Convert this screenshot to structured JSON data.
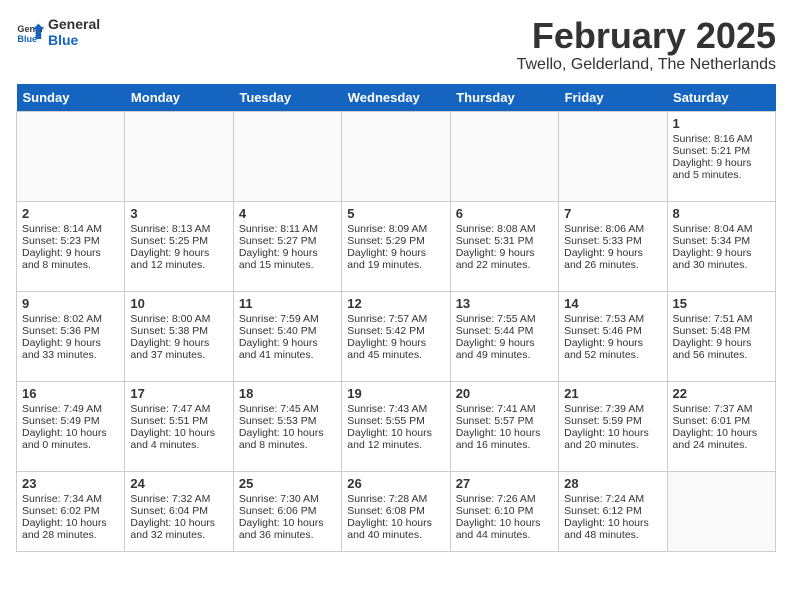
{
  "logo": {
    "line1": "General",
    "line2": "Blue"
  },
  "title": "February 2025",
  "subtitle": "Twello, Gelderland, The Netherlands",
  "weekdays": [
    "Sunday",
    "Monday",
    "Tuesday",
    "Wednesday",
    "Thursday",
    "Friday",
    "Saturday"
  ],
  "weeks": [
    [
      {
        "day": "",
        "info": ""
      },
      {
        "day": "",
        "info": ""
      },
      {
        "day": "",
        "info": ""
      },
      {
        "day": "",
        "info": ""
      },
      {
        "day": "",
        "info": ""
      },
      {
        "day": "",
        "info": ""
      },
      {
        "day": "1",
        "info": "Sunrise: 8:16 AM\nSunset: 5:21 PM\nDaylight: 9 hours and 5 minutes."
      }
    ],
    [
      {
        "day": "2",
        "info": "Sunrise: 8:14 AM\nSunset: 5:23 PM\nDaylight: 9 hours and 8 minutes."
      },
      {
        "day": "3",
        "info": "Sunrise: 8:13 AM\nSunset: 5:25 PM\nDaylight: 9 hours and 12 minutes."
      },
      {
        "day": "4",
        "info": "Sunrise: 8:11 AM\nSunset: 5:27 PM\nDaylight: 9 hours and 15 minutes."
      },
      {
        "day": "5",
        "info": "Sunrise: 8:09 AM\nSunset: 5:29 PM\nDaylight: 9 hours and 19 minutes."
      },
      {
        "day": "6",
        "info": "Sunrise: 8:08 AM\nSunset: 5:31 PM\nDaylight: 9 hours and 22 minutes."
      },
      {
        "day": "7",
        "info": "Sunrise: 8:06 AM\nSunset: 5:33 PM\nDaylight: 9 hours and 26 minutes."
      },
      {
        "day": "8",
        "info": "Sunrise: 8:04 AM\nSunset: 5:34 PM\nDaylight: 9 hours and 30 minutes."
      }
    ],
    [
      {
        "day": "9",
        "info": "Sunrise: 8:02 AM\nSunset: 5:36 PM\nDaylight: 9 hours and 33 minutes."
      },
      {
        "day": "10",
        "info": "Sunrise: 8:00 AM\nSunset: 5:38 PM\nDaylight: 9 hours and 37 minutes."
      },
      {
        "day": "11",
        "info": "Sunrise: 7:59 AM\nSunset: 5:40 PM\nDaylight: 9 hours and 41 minutes."
      },
      {
        "day": "12",
        "info": "Sunrise: 7:57 AM\nSunset: 5:42 PM\nDaylight: 9 hours and 45 minutes."
      },
      {
        "day": "13",
        "info": "Sunrise: 7:55 AM\nSunset: 5:44 PM\nDaylight: 9 hours and 49 minutes."
      },
      {
        "day": "14",
        "info": "Sunrise: 7:53 AM\nSunset: 5:46 PM\nDaylight: 9 hours and 52 minutes."
      },
      {
        "day": "15",
        "info": "Sunrise: 7:51 AM\nSunset: 5:48 PM\nDaylight: 9 hours and 56 minutes."
      }
    ],
    [
      {
        "day": "16",
        "info": "Sunrise: 7:49 AM\nSunset: 5:49 PM\nDaylight: 10 hours and 0 minutes."
      },
      {
        "day": "17",
        "info": "Sunrise: 7:47 AM\nSunset: 5:51 PM\nDaylight: 10 hours and 4 minutes."
      },
      {
        "day": "18",
        "info": "Sunrise: 7:45 AM\nSunset: 5:53 PM\nDaylight: 10 hours and 8 minutes."
      },
      {
        "day": "19",
        "info": "Sunrise: 7:43 AM\nSunset: 5:55 PM\nDaylight: 10 hours and 12 minutes."
      },
      {
        "day": "20",
        "info": "Sunrise: 7:41 AM\nSunset: 5:57 PM\nDaylight: 10 hours and 16 minutes."
      },
      {
        "day": "21",
        "info": "Sunrise: 7:39 AM\nSunset: 5:59 PM\nDaylight: 10 hours and 20 minutes."
      },
      {
        "day": "22",
        "info": "Sunrise: 7:37 AM\nSunset: 6:01 PM\nDaylight: 10 hours and 24 minutes."
      }
    ],
    [
      {
        "day": "23",
        "info": "Sunrise: 7:34 AM\nSunset: 6:02 PM\nDaylight: 10 hours and 28 minutes."
      },
      {
        "day": "24",
        "info": "Sunrise: 7:32 AM\nSunset: 6:04 PM\nDaylight: 10 hours and 32 minutes."
      },
      {
        "day": "25",
        "info": "Sunrise: 7:30 AM\nSunset: 6:06 PM\nDaylight: 10 hours and 36 minutes."
      },
      {
        "day": "26",
        "info": "Sunrise: 7:28 AM\nSunset: 6:08 PM\nDaylight: 10 hours and 40 minutes."
      },
      {
        "day": "27",
        "info": "Sunrise: 7:26 AM\nSunset: 6:10 PM\nDaylight: 10 hours and 44 minutes."
      },
      {
        "day": "28",
        "info": "Sunrise: 7:24 AM\nSunset: 6:12 PM\nDaylight: 10 hours and 48 minutes."
      },
      {
        "day": "",
        "info": ""
      }
    ]
  ]
}
